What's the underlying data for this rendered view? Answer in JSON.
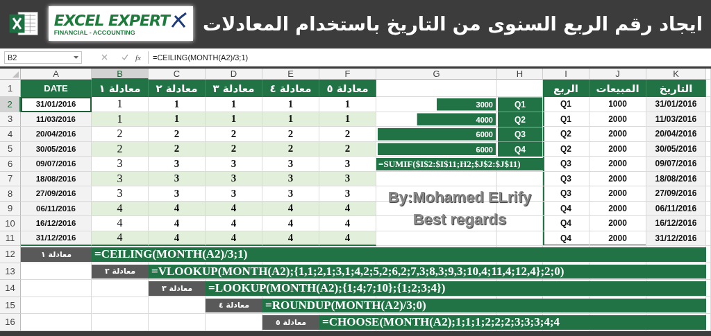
{
  "header": {
    "logo_text": "EXCEL EXPERT",
    "logo_tagline": "FINANCIAL - ACCOUNTING",
    "title": "ايجاد رقم الربع السنوى من التاريخ باستخدام المعادلات"
  },
  "formula_bar": {
    "name_box": "B2",
    "function_label": "fx",
    "formula": "=CEILING(MONTH(A2)/3;1)"
  },
  "columns": [
    {
      "label": "A",
      "selected": false
    },
    {
      "label": "B",
      "selected": true
    },
    {
      "label": "C",
      "selected": false
    },
    {
      "label": "D",
      "selected": false
    },
    {
      "label": "E",
      "selected": false
    },
    {
      "label": "F",
      "selected": false
    },
    {
      "label": "G",
      "selected": false
    },
    {
      "label": "H",
      "selected": false
    },
    {
      "label": "I",
      "selected": false
    },
    {
      "label": "J",
      "selected": false
    },
    {
      "label": "K",
      "selected": false
    }
  ],
  "rows": [
    {
      "label": "1",
      "selected": false
    },
    {
      "label": "2",
      "selected": true
    },
    {
      "label": "3",
      "selected": false
    },
    {
      "label": "4",
      "selected": false
    },
    {
      "label": "5",
      "selected": false
    },
    {
      "label": "6",
      "selected": false
    },
    {
      "label": "7",
      "selected": false
    },
    {
      "label": "8",
      "selected": false
    },
    {
      "label": "9",
      "selected": false
    },
    {
      "label": "10",
      "selected": false
    },
    {
      "label": "11",
      "selected": false
    },
    {
      "label": "12",
      "selected": false
    },
    {
      "label": "13",
      "selected": false
    },
    {
      "label": "14",
      "selected": false
    },
    {
      "label": "15",
      "selected": false
    },
    {
      "label": "16",
      "selected": false
    }
  ],
  "quarter_table": {
    "columns": [
      {
        "heading": "DATE"
      },
      {
        "heading": "معادلة ١"
      },
      {
        "heading": "معادلة ٢"
      },
      {
        "heading": "معادلة ٣"
      },
      {
        "heading": "معادلة ٤"
      },
      {
        "heading": "معادلة ٥"
      }
    ],
    "rows": [
      [
        "31/01/2016",
        "1",
        "1",
        "1",
        "1",
        "1"
      ],
      [
        "11/03/2016",
        "1",
        "1",
        "1",
        "1",
        "1"
      ],
      [
        "20/04/2016",
        "2",
        "2",
        "2",
        "2",
        "2"
      ],
      [
        "30/05/2016",
        "2",
        "2",
        "2",
        "2",
        "2"
      ],
      [
        "09/07/2016",
        "3",
        "3",
        "3",
        "3",
        "3"
      ],
      [
        "18/08/2016",
        "3",
        "3",
        "3",
        "3",
        "3"
      ],
      [
        "27/09/2016",
        "3",
        "3",
        "3",
        "3",
        "3"
      ],
      [
        "06/11/2016",
        "4",
        "4",
        "4",
        "4",
        "4"
      ],
      [
        "16/12/2016",
        "4",
        "4",
        "4",
        "4",
        "4"
      ],
      [
        "31/12/2016",
        "4",
        "4",
        "4",
        "4",
        "4"
      ]
    ]
  },
  "summary": {
    "chart_data": {
      "type": "bar",
      "orientation": "horizontal",
      "categories": [
        "Q1",
        "Q2",
        "Q3",
        "Q4"
      ],
      "values": [
        3000,
        4000,
        6000,
        6000
      ],
      "data_labels": true,
      "value_labels": [
        "3000",
        "4000",
        "6000",
        "6000"
      ]
    },
    "formula": "=SUMIF($I$2:$I$11;H2;$J$2:$J$11)"
  },
  "credit": [
    "By:Mohamed ELrify",
    "Best regards"
  ],
  "sales_table": {
    "columns": [
      {
        "heading": "الربع"
      },
      {
        "heading": "المبيعات"
      },
      {
        "heading": "التاريخ"
      }
    ],
    "rows": [
      [
        "Q1",
        "1000",
        "31/01/2016"
      ],
      [
        "Q1",
        "2000",
        "11/03/2016"
      ],
      [
        "Q2",
        "2000",
        "20/04/2016"
      ],
      [
        "Q2",
        "2000",
        "30/05/2016"
      ],
      [
        "Q3",
        "2000",
        "09/07/2016"
      ],
      [
        "Q3",
        "2000",
        "18/08/2016"
      ],
      [
        "Q3",
        "2000",
        "27/09/2016"
      ],
      [
        "Q4",
        "2000",
        "06/11/2016"
      ],
      [
        "Q4",
        "2000",
        "16/12/2016"
      ],
      [
        "Q4",
        "2000",
        "31/12/2016"
      ]
    ]
  },
  "formulas": [
    {
      "label": "معادلة ١",
      "formula": "=CEILING(MONTH(A2)/3;1)"
    },
    {
      "label": "معادلة ٢",
      "formula": "=VLOOKUP(MONTH(A2);{1,1;2,1;3,1;4,2;5,2;6,2;7,3;8,3;9,3;10,4;11,4;12,4};2;0)"
    },
    {
      "label": "معادلة ٣",
      "formula": "=LOOKUP(MONTH(A2);{1;4;7;10};{1;2;3;4})"
    },
    {
      "label": "معادلة ٤",
      "formula": "=ROUNDUP(MONTH(A2)/3;0)"
    },
    {
      "label": "معادلة ٥",
      "formula": "=CHOOSE(MONTH(A2);1;1;1;2;2;2;3;3;3;4;4"
    }
  ]
}
